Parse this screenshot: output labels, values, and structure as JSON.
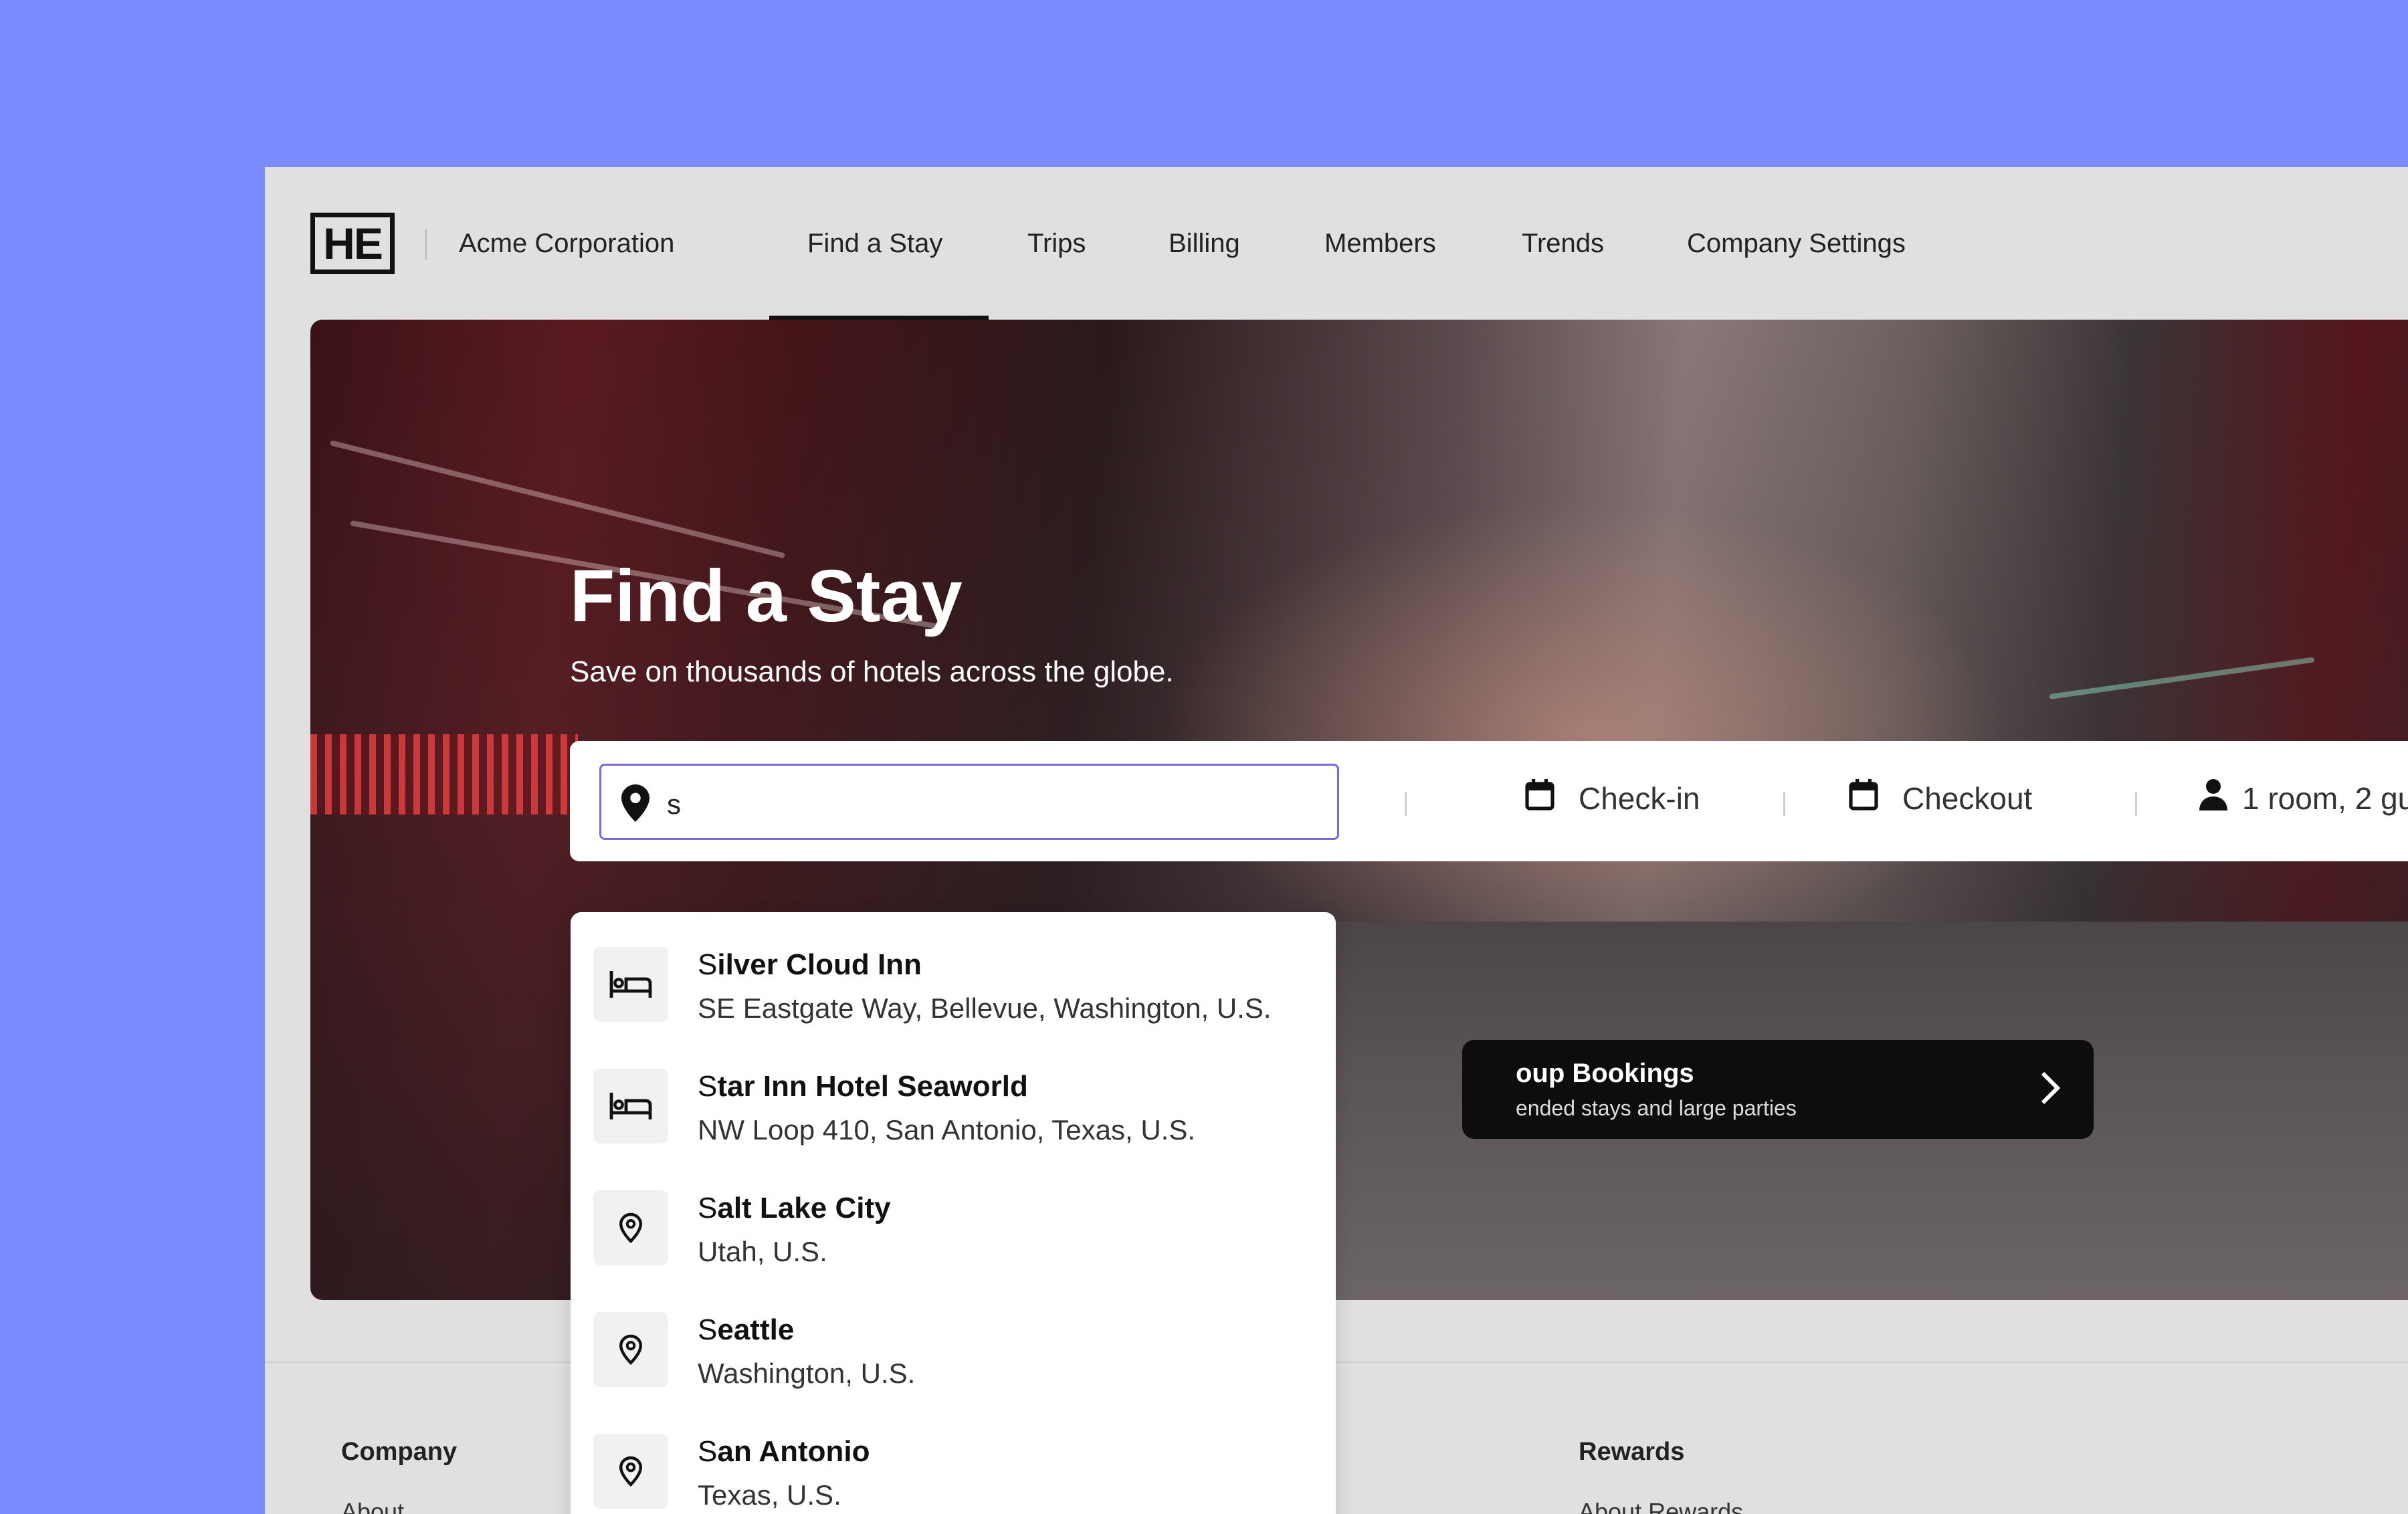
{
  "nav": {
    "logo_text": "HE",
    "company": "Acme Corporation",
    "items": [
      {
        "label": "Find a Stay",
        "active": true
      },
      {
        "label": "Trips"
      },
      {
        "label": "Billing"
      },
      {
        "label": "Members"
      },
      {
        "label": "Trends"
      },
      {
        "label": "Company Settings"
      }
    ]
  },
  "hero": {
    "title": "Find a Stay",
    "subtitle": "Save on thousands of hotels across the globe."
  },
  "search": {
    "destination_value": "s",
    "checkin_label": "Check-in",
    "checkout_label": "Checkout",
    "guests_label": "1 room, 2 gu"
  },
  "group_card": {
    "title": "oup Bookings",
    "subtitle": "ended stays and large parties"
  },
  "suggestions": [
    {
      "type": "hotel",
      "match": "S",
      "rest": "ilver Cloud Inn",
      "address": "SE Eastgate Way, Bellevue, Washington, U.S."
    },
    {
      "type": "hotel",
      "match": "S",
      "rest": "tar Inn Hotel Seaworld",
      "address": "NW Loop 410, San Antonio, Texas, U.S."
    },
    {
      "type": "city",
      "match": "S",
      "rest": "alt Lake City",
      "address": "Utah, U.S."
    },
    {
      "type": "city",
      "match": "S",
      "rest": "eattle",
      "address": "Washington, U.S."
    },
    {
      "type": "city",
      "match": "S",
      "rest": "an Antonio",
      "address": "Texas, U.S."
    }
  ],
  "footer": {
    "company_title": "Company",
    "company_link": "About",
    "rewards_title": "Rewards",
    "rewards_link": "About Rewards"
  },
  "colors": {
    "background": "#7b8cff",
    "input_focus": "#7a6ad8"
  }
}
